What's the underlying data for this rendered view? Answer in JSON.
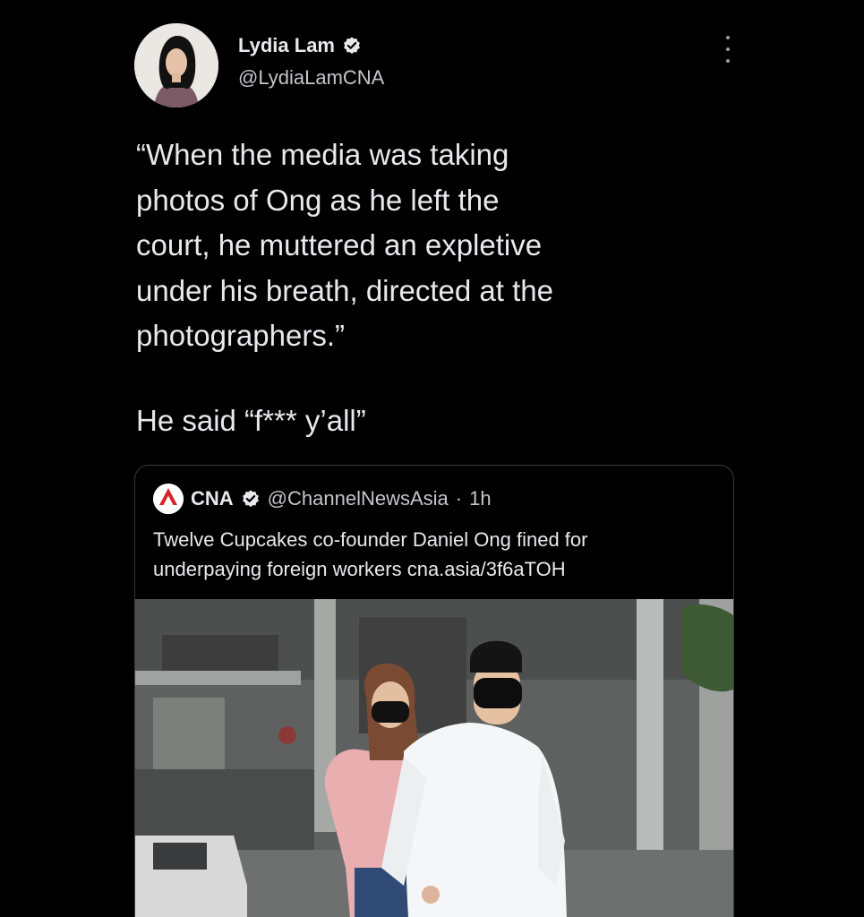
{
  "tweet": {
    "author": {
      "display_name": "Lydia Lam",
      "handle": "@LydiaLamCNA",
      "verified": true,
      "avatar_icon": "profile-photo"
    },
    "more_icon": "vertical-ellipsis-icon",
    "text": [
      "“When the media was taking",
      "photos of Ong as he left the",
      "court, he muttered an expletive",
      "under his breath, directed at the",
      "photographers.”",
      "He said “f*** y’all”"
    ]
  },
  "quoted_tweet": {
    "display_name": "CNA",
    "handle": "@ChannelNewsAsia",
    "separator": "·",
    "time": "1h",
    "logo_text": "cna",
    "text_line1": "Twelve Cupcakes co-founder Daniel Ong fined for",
    "text_line2": "underpaying foreign workers cna.asia/3f6aTOH",
    "image": "news-photo"
  },
  "colors": {
    "background": "#000000",
    "text": "#e7e9ea",
    "secondary": "#c4c6c8",
    "verified": "#e7e9ea",
    "cna_red": "#d8232a"
  }
}
